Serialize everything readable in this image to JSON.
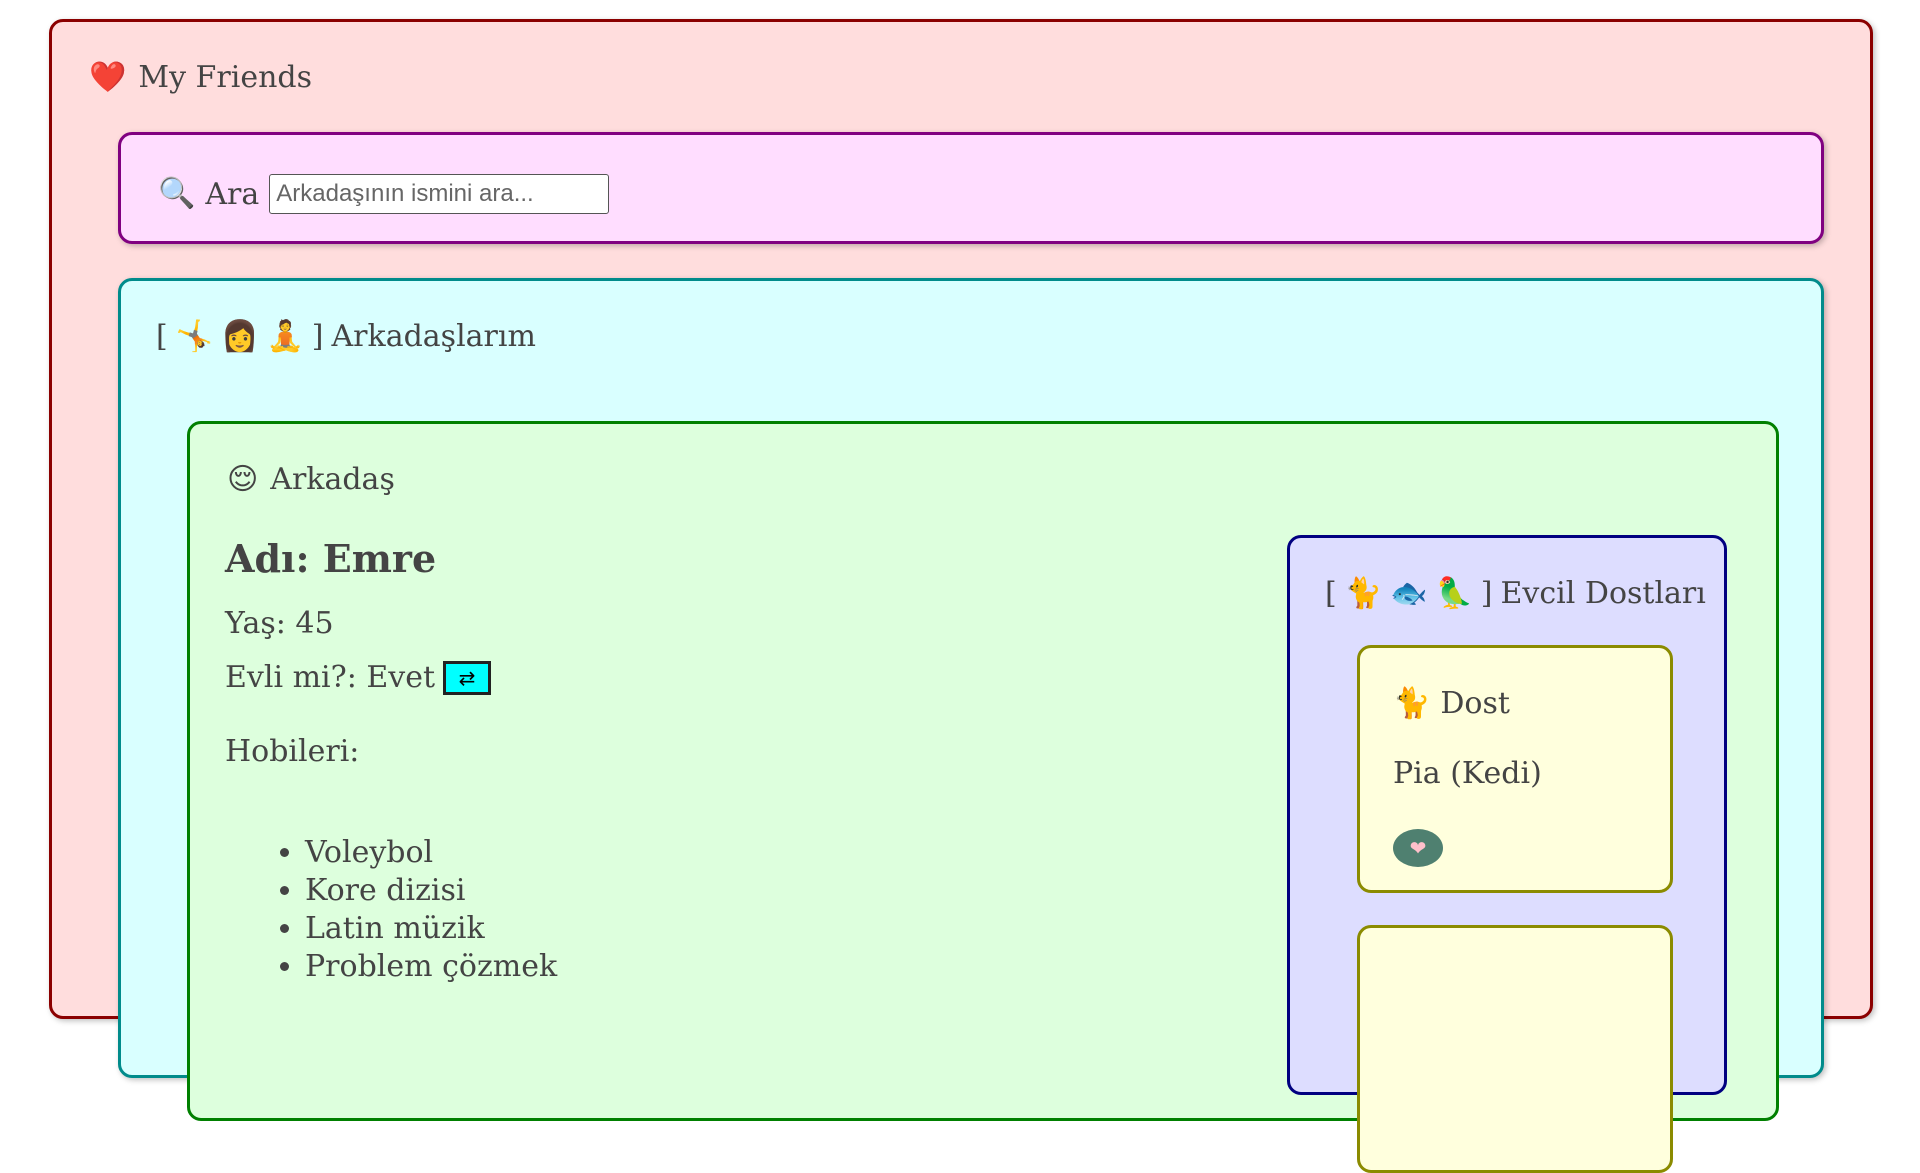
{
  "app": {
    "title": "My Friends",
    "title_icon": "❤️"
  },
  "search": {
    "icon": "🔍",
    "label": "Ara",
    "placeholder": "Arkadaşının ismini ara...",
    "value": ""
  },
  "friends_section": {
    "bracket_open": "[",
    "icons": [
      "🤸",
      "👩",
      "🧘"
    ],
    "bracket_close": "]",
    "title": "Arkadaşlarım"
  },
  "friend": {
    "header_icon": "😌",
    "header_label": "Arkadaş",
    "name": "Adı: Emre",
    "age": "Yaş: 45",
    "married": "Evli mi?: Evet",
    "toggle_icon": "⇄",
    "hobbies_label": "Hobileri:",
    "hobbies": [
      "Voleybol",
      "Kore dizisi",
      "Latin müzik",
      "Problem çözmek"
    ]
  },
  "pets": {
    "bracket_open": "[",
    "icons": [
      "🐈",
      "🐟",
      "🦜"
    ],
    "bracket_close": "]",
    "title": "Evcil Dostları",
    "items": [
      {
        "icon": "🐈",
        "label": "Dost",
        "name": "Pia (Kedi)",
        "like_icon": "❤"
      },
      {
        "icon": "",
        "label": "",
        "name": "",
        "like_icon": ""
      }
    ]
  },
  "colors": {
    "app_border": "#8b0000",
    "app_bg": "#ffdddd",
    "search_border": "#800080",
    "search_bg": "#ffddff",
    "friends_border": "#008b8b",
    "friends_bg": "#d9ffff",
    "friend_border": "#008000",
    "friend_bg": "#ddffdd",
    "pets_border": "#000080",
    "pets_bg": "#ddddff",
    "pet_border": "#8b8b00",
    "pet_bg": "#ffffdd",
    "toggle_bg": "#00ffff",
    "like_bg": "#4f8070"
  }
}
